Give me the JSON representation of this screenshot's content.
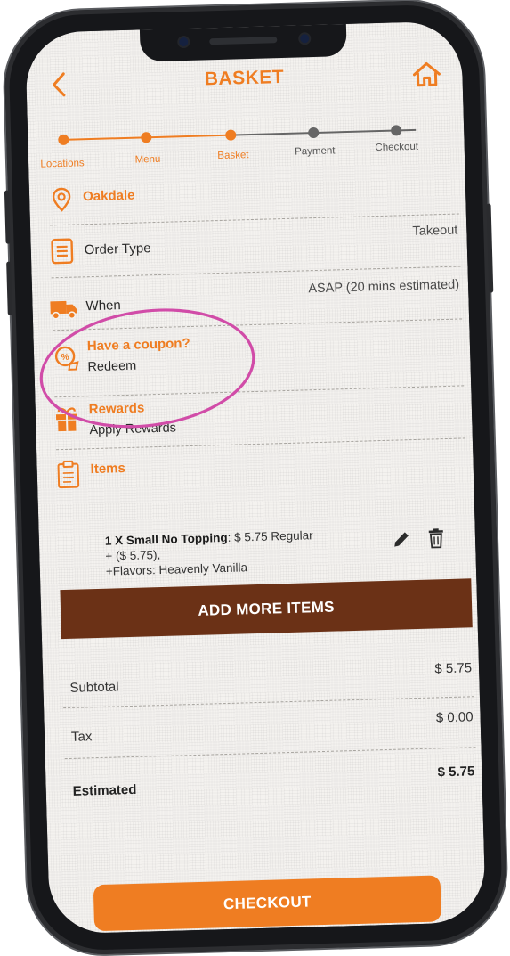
{
  "header": {
    "title": "BASKET"
  },
  "stepper": {
    "steps": [
      {
        "label": "Locations",
        "state": "done"
      },
      {
        "label": "Menu",
        "state": "done"
      },
      {
        "label": "Basket",
        "state": "current"
      },
      {
        "label": "Payment",
        "state": "todo"
      },
      {
        "label": "Checkout",
        "state": "todo"
      }
    ]
  },
  "location": {
    "name": "Oakdale"
  },
  "order_type": {
    "label": "Order Type",
    "value": "Takeout"
  },
  "when": {
    "label": "When",
    "value": "ASAP (20 mins estimated)"
  },
  "coupon": {
    "title": "Have a coupon?",
    "action": "Redeem"
  },
  "rewards": {
    "title": "Rewards",
    "action": "Apply Rewards"
  },
  "items": {
    "title": "Items",
    "list": [
      {
        "name": "1 X Small No Topping",
        "detail": ": $ 5.75 Regular",
        "line2": "+ ($ 5.75),",
        "line3": "+Flavors: Heavenly Vanilla"
      }
    ]
  },
  "add_more_label": "ADD MORE ITEMS",
  "totals": {
    "subtotal_label": "Subtotal",
    "subtotal_value": "$ 5.75",
    "tax_label": "Tax",
    "tax_value": "$ 0.00",
    "estimated_label": "Estimated",
    "estimated_value": "$ 5.75"
  },
  "checkout_label": "CHECKOUT",
  "colors": {
    "accent": "#ef7d22",
    "brown": "#6b3116",
    "annotation": "#d14ca8",
    "inactive": "#666666"
  }
}
